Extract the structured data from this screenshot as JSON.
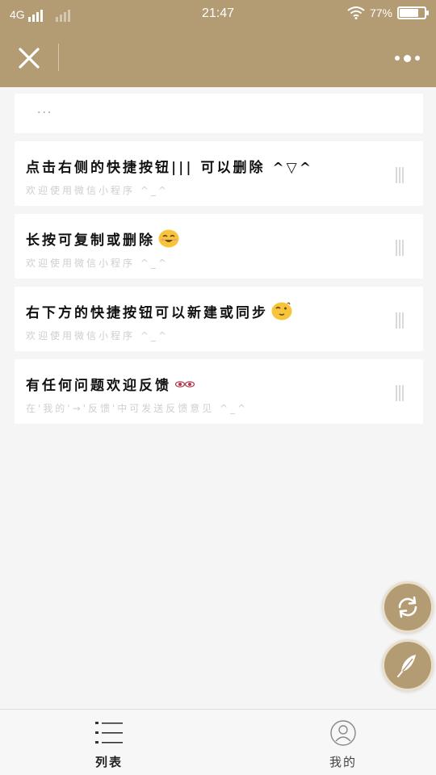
{
  "status_bar": {
    "network": "4G",
    "time": "21:47",
    "battery_text": "77%",
    "battery_level": 0.77
  },
  "nav": {
    "close_icon": "close-icon",
    "more_icon": "more-dots-icon"
  },
  "search": {
    "text": "..."
  },
  "notes": [
    {
      "title": "点击右侧的快捷按钮||| 可以删除 ^▽^",
      "subtitle": "欢迎使用微信小程序 ^_^"
    },
    {
      "title": "长按可复制或删除",
      "subtitle": "欢迎使用微信小程序 ^_^",
      "emoji": "smile-emoji"
    },
    {
      "title": "右下方的快捷按钮可以新建或同步",
      "subtitle": "欢迎使用微信小程序 ^_^",
      "emoji": "wink-emoji"
    },
    {
      "title": "有任何问题欢迎反馈",
      "subtitle": "在'我的'→'反馈'中可发送反馈意见 ^_^",
      "emoji": "eyes-emoji"
    }
  ],
  "fabs": {
    "sync_icon": "sync-icon",
    "new_icon": "feather-icon"
  },
  "tab_bar": {
    "tabs": [
      {
        "label": "列表",
        "icon": "list-icon",
        "selected": true
      },
      {
        "label": "我的",
        "icon": "user-icon",
        "selected": false
      }
    ]
  },
  "colors": {
    "brand": "#b39b74",
    "fab_border": "#eadfcb",
    "subtitle": "#cfcfcf",
    "background": "#f5f5f5"
  }
}
